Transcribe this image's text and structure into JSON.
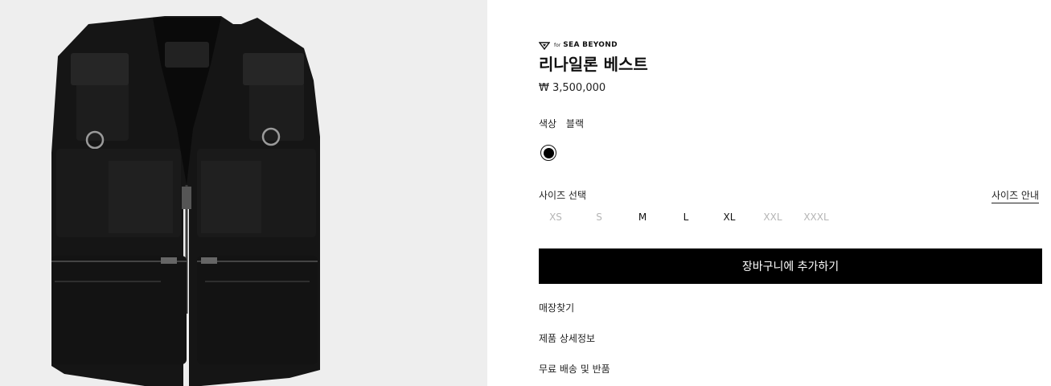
{
  "brand": {
    "for_text": "for",
    "collection_name": "SEA BEYOND",
    "logo_icon": "triangle-heart-logo-icon"
  },
  "product": {
    "name": "리나일론 베스트",
    "price": "₩ 3,500,000"
  },
  "color": {
    "label": "색상",
    "value": "블랙",
    "swatches": [
      {
        "name": "블랙",
        "hex": "#000000",
        "selected": true
      }
    ]
  },
  "size": {
    "label": "사이즈 선택",
    "guide_link": "사이즈 안내",
    "options": [
      {
        "label": "XS",
        "available": false
      },
      {
        "label": "S",
        "available": false
      },
      {
        "label": "M",
        "available": true
      },
      {
        "label": "L",
        "available": true
      },
      {
        "label": "XL",
        "available": true
      },
      {
        "label": "XXL",
        "available": false
      },
      {
        "label": "XXXL",
        "available": false
      }
    ]
  },
  "cart_button_label": "장바구니에 추가하기",
  "links": {
    "store_finder": "매장찾기",
    "product_details": "제품 상세정보",
    "shipping_returns": "무료 배송 및 반품"
  },
  "colors": {
    "image_background": "#eeeeee",
    "button_background": "#000000",
    "unavailable_size": "#b5b5b5"
  }
}
